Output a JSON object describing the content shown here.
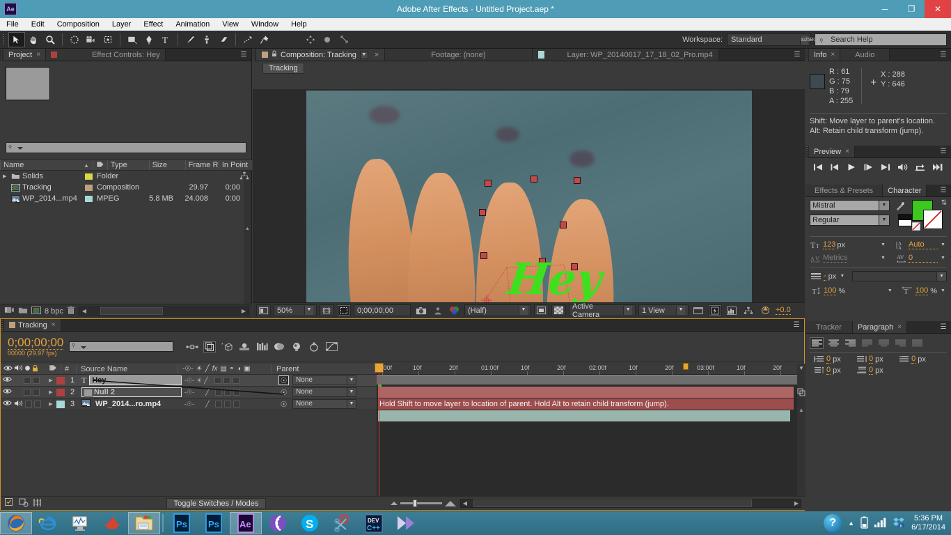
{
  "titlebar": {
    "app_badge": "Ae",
    "title": "Adobe After Effects - Untitled Project.aep *",
    "minimize": "─",
    "maximize": "❐",
    "close": "✕"
  },
  "menubar": {
    "items": [
      "File",
      "Edit",
      "Composition",
      "Layer",
      "Effect",
      "Animation",
      "View",
      "Window",
      "Help"
    ]
  },
  "toolbar": {
    "workspace_label": "Workspace:",
    "workspace_value": "Standard",
    "search_help_placeholder": "Search Help",
    "tools": [
      {
        "name": "selection-tool",
        "glyph": "➤"
      },
      {
        "name": "hand-tool",
        "glyph": "✋"
      },
      {
        "name": "zoom-tool",
        "glyph": "⌕"
      },
      {
        "name": "rotation-tool",
        "glyph": "↻"
      },
      {
        "name": "camera-tool",
        "glyph": "Ἲ5"
      },
      {
        "name": "pan-behind-tool",
        "glyph": "✥"
      },
      {
        "name": "shape-tool",
        "glyph": "■"
      },
      {
        "name": "pen-tool",
        "glyph": "✒"
      },
      {
        "name": "type-tool",
        "glyph": "T"
      },
      {
        "name": "brush-tool",
        "glyph": "╱"
      },
      {
        "name": "clone-stamp-tool",
        "glyph": "⚙"
      },
      {
        "name": "eraser-tool",
        "glyph": "▱"
      },
      {
        "name": "roto-brush-tool",
        "glyph": "✒"
      },
      {
        "name": "puppet-pin-tool",
        "glyph": "⚑"
      }
    ]
  },
  "project_panel": {
    "tabs": [
      {
        "label": "Project",
        "active": true,
        "closable": true
      },
      {
        "label": "Effect Controls: Hey",
        "active": false,
        "closable": false
      }
    ],
    "search_placeholder": "",
    "columns": [
      "Name",
      "Type",
      "Size",
      "Frame R...",
      "In Point"
    ],
    "rows": [
      {
        "name": "Solids",
        "icon": "folder-icon",
        "label_color": "#d8d84a",
        "type": "Folder",
        "size": "",
        "frame_rate": "",
        "in_point": ""
      },
      {
        "name": "Tracking",
        "icon": "composition-icon",
        "label_color": "#c0a080",
        "type": "Composition",
        "size": "",
        "frame_rate": "29.97",
        "in_point": "0;00"
      },
      {
        "name": "WP_2014...mp4",
        "icon": "footage-icon",
        "label_color": "#a8d8d8",
        "type": "MPEG",
        "size": "5.8 MB",
        "frame_rate": "24.008",
        "in_point": "0:00"
      }
    ],
    "bit_depth": "8 bpc"
  },
  "comp_panel": {
    "tabs": [
      {
        "label": "Composition: Tracking",
        "active": true,
        "has_dropdown": true,
        "closable": true
      },
      {
        "label": "Footage: (none)",
        "active": false,
        "has_dropdown": false,
        "closable": false
      },
      {
        "label": "Layer: WP_20140617_17_18_02_Pro.mp4",
        "active": false,
        "has_dropdown": false,
        "closable": false
      }
    ],
    "sub_tab": "Tracking",
    "stage_text": "Hey",
    "bottom_bar": {
      "zoom": "50%",
      "timecode": "0;00;00;00",
      "resolution": "(Half)",
      "view": "Active Camera",
      "view_layout": "1 View",
      "exposure": "+0.0"
    }
  },
  "info_panel": {
    "tabs": [
      {
        "label": "Info",
        "active": true,
        "closable": true
      },
      {
        "label": "Audio",
        "active": false,
        "closable": false
      }
    ],
    "swatch_color": "#3d4b4f",
    "r": "R : 61",
    "g": "G : 75",
    "b": "B : 79",
    "a": "A : 255",
    "x": "X : 288",
    "y": "Y : 646",
    "hint_line1": "Shift: Move layer to parent's location.",
    "hint_line2": "Alt: Retain child transform (jump)."
  },
  "preview_panel": {
    "tabs": [
      {
        "label": "Preview",
        "active": true,
        "closable": true
      }
    ],
    "buttons": [
      {
        "name": "first-frame-button",
        "glyph": "⏮"
      },
      {
        "name": "previous-frame-button",
        "glyph": "◀|"
      },
      {
        "name": "play-button",
        "glyph": "▶"
      },
      {
        "name": "next-frame-button",
        "glyph": "|▶"
      },
      {
        "name": "last-frame-button",
        "glyph": "⏭"
      },
      {
        "name": "audio-toggle-button",
        "glyph": "ὐA"
      },
      {
        "name": "loop-button",
        "glyph": "↻"
      },
      {
        "name": "ram-preview-button",
        "glyph": "▶▶"
      }
    ]
  },
  "character_panel": {
    "tabs": [
      {
        "label": "Effects & Presets",
        "active": false,
        "closable": false
      },
      {
        "label": "Character",
        "active": true,
        "closable": false
      }
    ],
    "font_family": "Mistral",
    "font_style": "Regular",
    "fill_color": "#3cc81e",
    "font_size": "123",
    "font_size_unit": "px",
    "leading": "Auto",
    "kerning": "Metrics",
    "tracking": "0",
    "vertical_scale": "100",
    "horizontal_scale": "100",
    "baseline_shift": "-",
    "baseline_unit": "px"
  },
  "paragraph_panel": {
    "tabs": [
      {
        "label": "Tracker",
        "active": false,
        "closable": false
      },
      {
        "label": "Paragraph",
        "active": true,
        "closable": true
      }
    ],
    "indents": [
      {
        "name": "indent-left-margin",
        "value": "0",
        "unit": "px"
      },
      {
        "name": "indent-right-margin",
        "value": "0",
        "unit": "px"
      },
      {
        "name": "indent-first-line",
        "value": "0",
        "unit": "px"
      },
      {
        "name": "space-before-paragraph",
        "value": "0",
        "unit": "px"
      },
      {
        "name": "space-after-paragraph",
        "value": "0",
        "unit": "px"
      }
    ]
  },
  "timeline": {
    "tabs": [
      {
        "label": "Tracking",
        "active": true,
        "closable": true
      }
    ],
    "current_time": "0;00;00;00",
    "frame_info": "00000 (29.97 fps)",
    "search_placeholder": "",
    "columns": {
      "source_name": "Source Name",
      "number": "#",
      "parent": "Parent"
    },
    "layers": [
      {
        "index": "1",
        "name": "Hey",
        "type": "text",
        "color": "#b04040",
        "parent": "None",
        "editing": true,
        "audio": false
      },
      {
        "index": "2",
        "name": "Null 2",
        "type": "null",
        "color": "#b04040",
        "parent": "None",
        "editing": false,
        "audio": false
      },
      {
        "index": "3",
        "name": "WP_2014...ro.mp4",
        "type": "footage",
        "color": "#a8d8d8",
        "parent": "None",
        "editing": false,
        "audio": true
      }
    ],
    "ruler_labels": [
      "0;00f",
      "10f",
      "20f",
      "01:00f",
      "10f",
      "20f",
      "02:00f",
      "10f",
      "20f",
      "03:00f",
      "10f",
      "20f"
    ],
    "tooltip": "Hold Shift to move layer to location of parent. Hold Alt to retain child transform (jump).",
    "toggle_switches": "Toggle Switches / Modes"
  },
  "taskbar": {
    "apps": [
      {
        "name": "firefox",
        "glyph": "",
        "active": true
      },
      {
        "name": "internet-explorer",
        "glyph": "e",
        "active": false
      },
      {
        "name": "system-monitor",
        "glyph": "",
        "active": false
      },
      {
        "name": "matlab",
        "glyph": "",
        "active": false
      },
      {
        "name": "file-explorer",
        "glyph": "",
        "active": true
      },
      {
        "name": "photoshop-1",
        "glyph": "Ps",
        "active": false
      },
      {
        "name": "photoshop-2",
        "glyph": "Ps",
        "active": false
      },
      {
        "name": "after-effects",
        "glyph": "Ae",
        "active": true
      },
      {
        "name": "bittorrent",
        "glyph": "",
        "active": false
      },
      {
        "name": "skype",
        "glyph": "S",
        "active": false
      },
      {
        "name": "snipping-tool",
        "glyph": "",
        "active": false
      },
      {
        "name": "dev-cpp",
        "glyph": "DEV",
        "active": false
      },
      {
        "name": "media-player",
        "glyph": "",
        "active": false
      }
    ],
    "tray": {
      "help": "?",
      "show_hidden": "▲",
      "battery": "ὐB",
      "network": "὏6",
      "dropbox": "❄",
      "time": "5:36 PM",
      "date": "6/17/2014"
    }
  }
}
